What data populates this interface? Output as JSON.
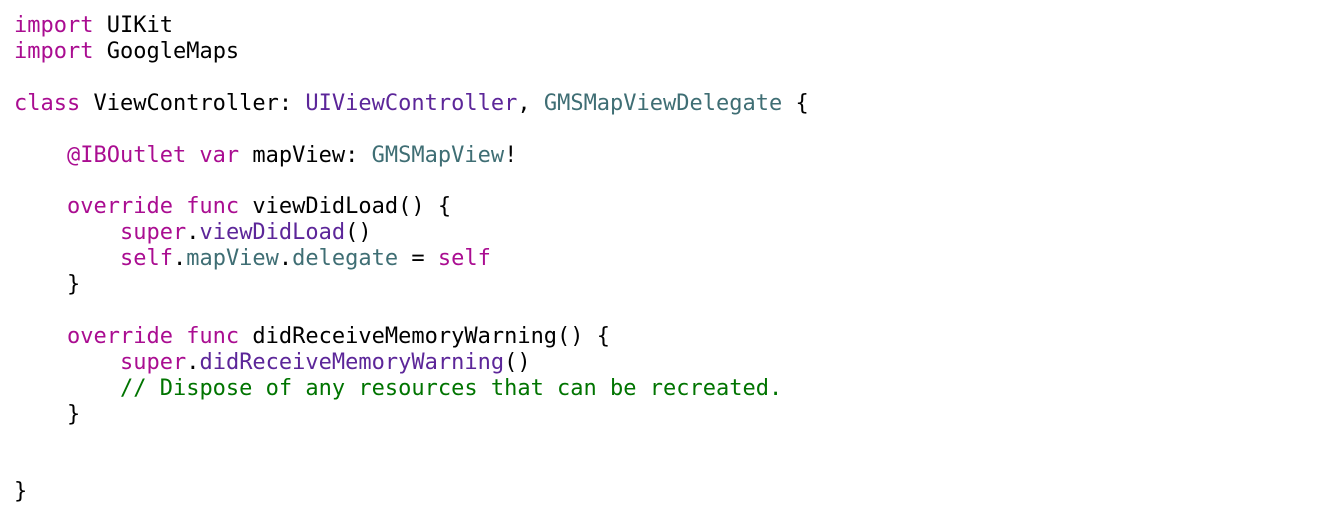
{
  "editor": {
    "language": "swift",
    "colors": {
      "keyword": "#aa0d91",
      "type": "#3f6e74",
      "method_call": "#5c2699",
      "comment": "#007400",
      "plain": "#000000",
      "background": "#ffffff"
    },
    "lines": [
      {
        "tokens": [
          {
            "t": "import",
            "k": "keyword"
          },
          {
            "t": " UIKit",
            "k": "plain"
          }
        ]
      },
      {
        "tokens": [
          {
            "t": "import",
            "k": "keyword"
          },
          {
            "t": " GoogleMaps",
            "k": "plain"
          }
        ]
      },
      {
        "tokens": []
      },
      {
        "tokens": [
          {
            "t": "class",
            "k": "keyword"
          },
          {
            "t": " ViewController: ",
            "k": "plain"
          },
          {
            "t": "UIViewController",
            "k": "method_call"
          },
          {
            "t": ", ",
            "k": "plain"
          },
          {
            "t": "GMSMapViewDelegate",
            "k": "type"
          },
          {
            "t": " {",
            "k": "plain"
          }
        ]
      },
      {
        "tokens": []
      },
      {
        "tokens": [
          {
            "t": "    ",
            "k": "plain"
          },
          {
            "t": "@IBOutlet var",
            "k": "keyword"
          },
          {
            "t": " mapView: ",
            "k": "plain"
          },
          {
            "t": "GMSMapView",
            "k": "type"
          },
          {
            "t": "!",
            "k": "plain"
          }
        ]
      },
      {
        "tokens": []
      },
      {
        "tokens": [
          {
            "t": "    ",
            "k": "plain"
          },
          {
            "t": "override func",
            "k": "keyword"
          },
          {
            "t": " viewDidLoad() {",
            "k": "plain"
          }
        ]
      },
      {
        "tokens": [
          {
            "t": "        ",
            "k": "plain"
          },
          {
            "t": "super",
            "k": "keyword"
          },
          {
            "t": ".",
            "k": "plain"
          },
          {
            "t": "viewDidLoad",
            "k": "method_call"
          },
          {
            "t": "()",
            "k": "plain"
          }
        ]
      },
      {
        "tokens": [
          {
            "t": "        ",
            "k": "plain"
          },
          {
            "t": "self",
            "k": "keyword"
          },
          {
            "t": ".",
            "k": "plain"
          },
          {
            "t": "mapView",
            "k": "type"
          },
          {
            "t": ".",
            "k": "plain"
          },
          {
            "t": "delegate",
            "k": "type"
          },
          {
            "t": " = ",
            "k": "plain"
          },
          {
            "t": "self",
            "k": "keyword"
          }
        ]
      },
      {
        "tokens": [
          {
            "t": "    }",
            "k": "plain"
          }
        ]
      },
      {
        "tokens": []
      },
      {
        "tokens": [
          {
            "t": "    ",
            "k": "plain"
          },
          {
            "t": "override func",
            "k": "keyword"
          },
          {
            "t": " didReceiveMemoryWarning() {",
            "k": "plain"
          }
        ]
      },
      {
        "tokens": [
          {
            "t": "        ",
            "k": "plain"
          },
          {
            "t": "super",
            "k": "keyword"
          },
          {
            "t": ".",
            "k": "plain"
          },
          {
            "t": "didReceiveMemoryWarning",
            "k": "method_call"
          },
          {
            "t": "()",
            "k": "plain"
          }
        ]
      },
      {
        "tokens": [
          {
            "t": "        ",
            "k": "plain"
          },
          {
            "t": "// Dispose of any resources that can be recreated.",
            "k": "comment"
          }
        ]
      },
      {
        "tokens": [
          {
            "t": "    }",
            "k": "plain"
          }
        ]
      },
      {
        "tokens": []
      },
      {
        "tokens": []
      },
      {
        "tokens": [
          {
            "t": "}",
            "k": "plain"
          }
        ]
      }
    ]
  }
}
